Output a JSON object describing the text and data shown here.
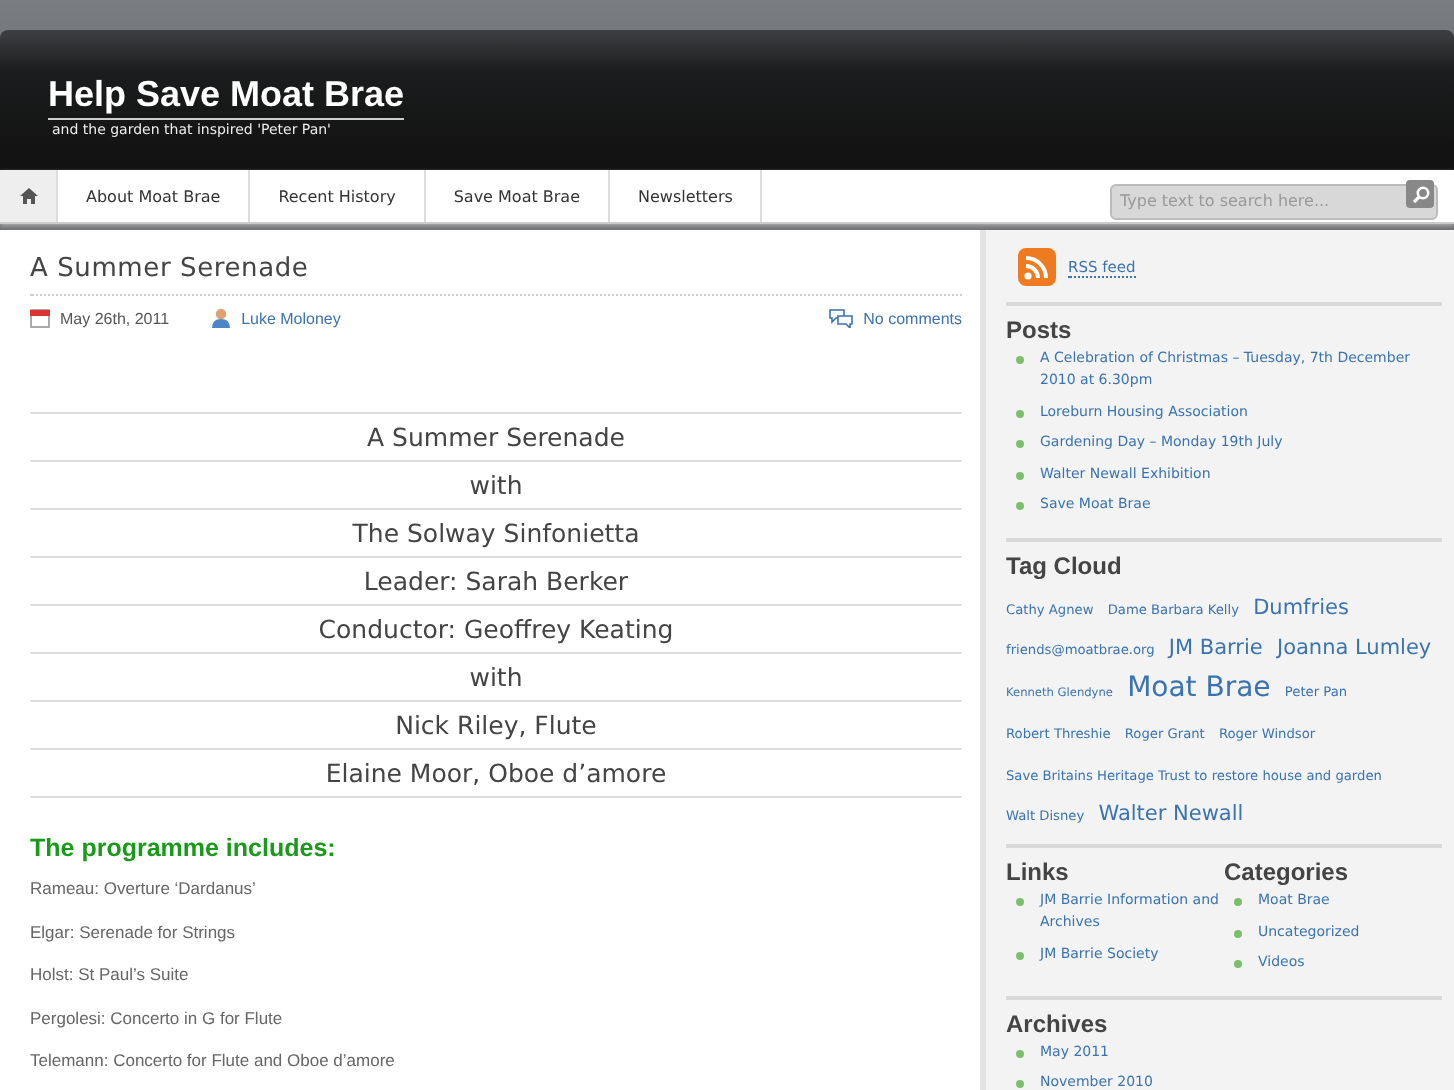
{
  "site": {
    "title": "Help Save Moat Brae",
    "tagline": "and the garden that inspired 'Peter Pan'"
  },
  "nav": {
    "items": [
      {
        "label": "About Moat Brae"
      },
      {
        "label": "Recent History"
      },
      {
        "label": "Save Moat Brae"
      },
      {
        "label": "Newsletters"
      }
    ],
    "search": {
      "placeholder": "Type text to search here..."
    }
  },
  "post": {
    "title": "A Summer Serenade",
    "date": "May 26th, 2011",
    "author": "Luke Moloney",
    "comments": "No comments",
    "lines": [
      "A Summer Serenade",
      "with",
      "The Solway Sinfonietta",
      "Leader: Sarah Berker",
      "Conductor: Geoffrey Keating",
      "with",
      "Nick Riley, Flute",
      "Elaine Moor, Oboe d’amore"
    ],
    "programme_heading": "The programme includes:",
    "programme": [
      "Rameau: Overture ‘Dardanus’",
      "Elgar: Serenade for Strings",
      "Holst: St Paul’s Suite",
      "Pergolesi: Concerto in G for Flute",
      "Telemann: Concerto for Flute and Oboe d’amore"
    ]
  },
  "sidebar": {
    "rss": "RSS feed",
    "posts": {
      "title": "Posts",
      "items": [
        "A Celebration of Christmas – Tuesday, 7th December 2010 at 6.30pm",
        "Loreburn Housing Association",
        "Gardening Day – Monday 19th July",
        "Walter Newall Exhibition",
        "Save Moat Brae"
      ]
    },
    "tag_cloud": {
      "title": "Tag Cloud",
      "tags": [
        {
          "label": "Cathy Agnew",
          "kind": "small"
        },
        {
          "label": "Dame Barbara Kelly",
          "kind": "small"
        },
        {
          "label": "Dumfries",
          "kind": "medium"
        },
        {
          "label": "friends@moatbrae.org",
          "kind": "small"
        },
        {
          "label": "JM Barrie",
          "kind": "medium"
        },
        {
          "label": "Joanna Lumley",
          "kind": "medium"
        },
        {
          "label": "Kenneth Glendyne",
          "kind": "tiny"
        },
        {
          "label": "Moat Brae",
          "kind": "large"
        },
        {
          "label": "Peter Pan",
          "kind": "small"
        },
        {
          "label": "Robert Threshie",
          "kind": "small"
        },
        {
          "label": "Roger Grant",
          "kind": "small"
        },
        {
          "label": "Roger Windsor",
          "kind": "small"
        },
        {
          "label": "Save Britains Heritage Trust to restore house and garden",
          "kind": "small"
        },
        {
          "label": "Walt Disney",
          "kind": "small"
        },
        {
          "label": "Walter Newall",
          "kind": "medium"
        }
      ]
    },
    "links": {
      "title": "Links",
      "items": [
        "JM Barrie Information and Archives",
        "JM Barrie Society"
      ]
    },
    "categories": {
      "title": "Categories",
      "items": [
        "Moat Brae",
        "Uncategorized",
        "Videos"
      ]
    },
    "archives": {
      "title": "Archives",
      "items": [
        "May 2011",
        "November 2010"
      ]
    }
  }
}
